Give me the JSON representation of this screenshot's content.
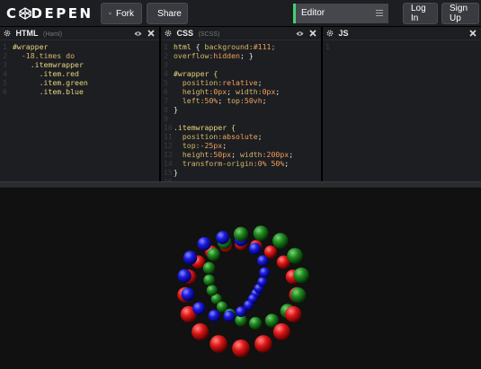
{
  "header": {
    "logo_text": "C DEPEN",
    "fork_label": "Fork",
    "share_label": "Share",
    "view_select": "Editor",
    "login_label": "Log In",
    "signup_label": "Sign Up"
  },
  "panes": {
    "html": {
      "title": "HTML",
      "preprocessor": "(Haml)",
      "lines": [
        {
          "n": "1",
          "indent": "",
          "text": "#wrapper",
          "cls": "sel"
        },
        {
          "n": "2",
          "indent": "  ",
          "text": "-18.times do",
          "cls": "prop"
        },
        {
          "n": "3",
          "indent": "    ",
          "text": ".itemwrapper",
          "cls": "sel"
        },
        {
          "n": "4",
          "indent": "      ",
          "text": ".item.red",
          "cls": "sel"
        },
        {
          "n": "5",
          "indent": "      ",
          "text": ".item.green",
          "cls": "sel"
        },
        {
          "n": "6",
          "indent": "      ",
          "text": ".item.blue",
          "cls": "sel"
        }
      ]
    },
    "css": {
      "title": "CSS",
      "preprocessor": "(SCSS)",
      "lines": [
        "html { background:#111;",
        "overflow:hidden; }",
        "",
        "#wrapper {",
        "  position:relative;",
        "  height:0px; width:0px;",
        "  left:50%; top:50vh;",
        "}",
        "",
        ".itemwrapper {",
        "  position:absolute;",
        "  top:-25px;",
        "  height:50px; width:200px;",
        "  transform-origin:0% 50%;",
        "}",
        ""
      ]
    },
    "js": {
      "title": "JS",
      "lines": [
        "1"
      ]
    }
  },
  "preview": {
    "ring_count": 18,
    "colors": {
      "red": "#e01818",
      "green": "#1e8a1e",
      "blue": "#1a1ae0"
    }
  }
}
